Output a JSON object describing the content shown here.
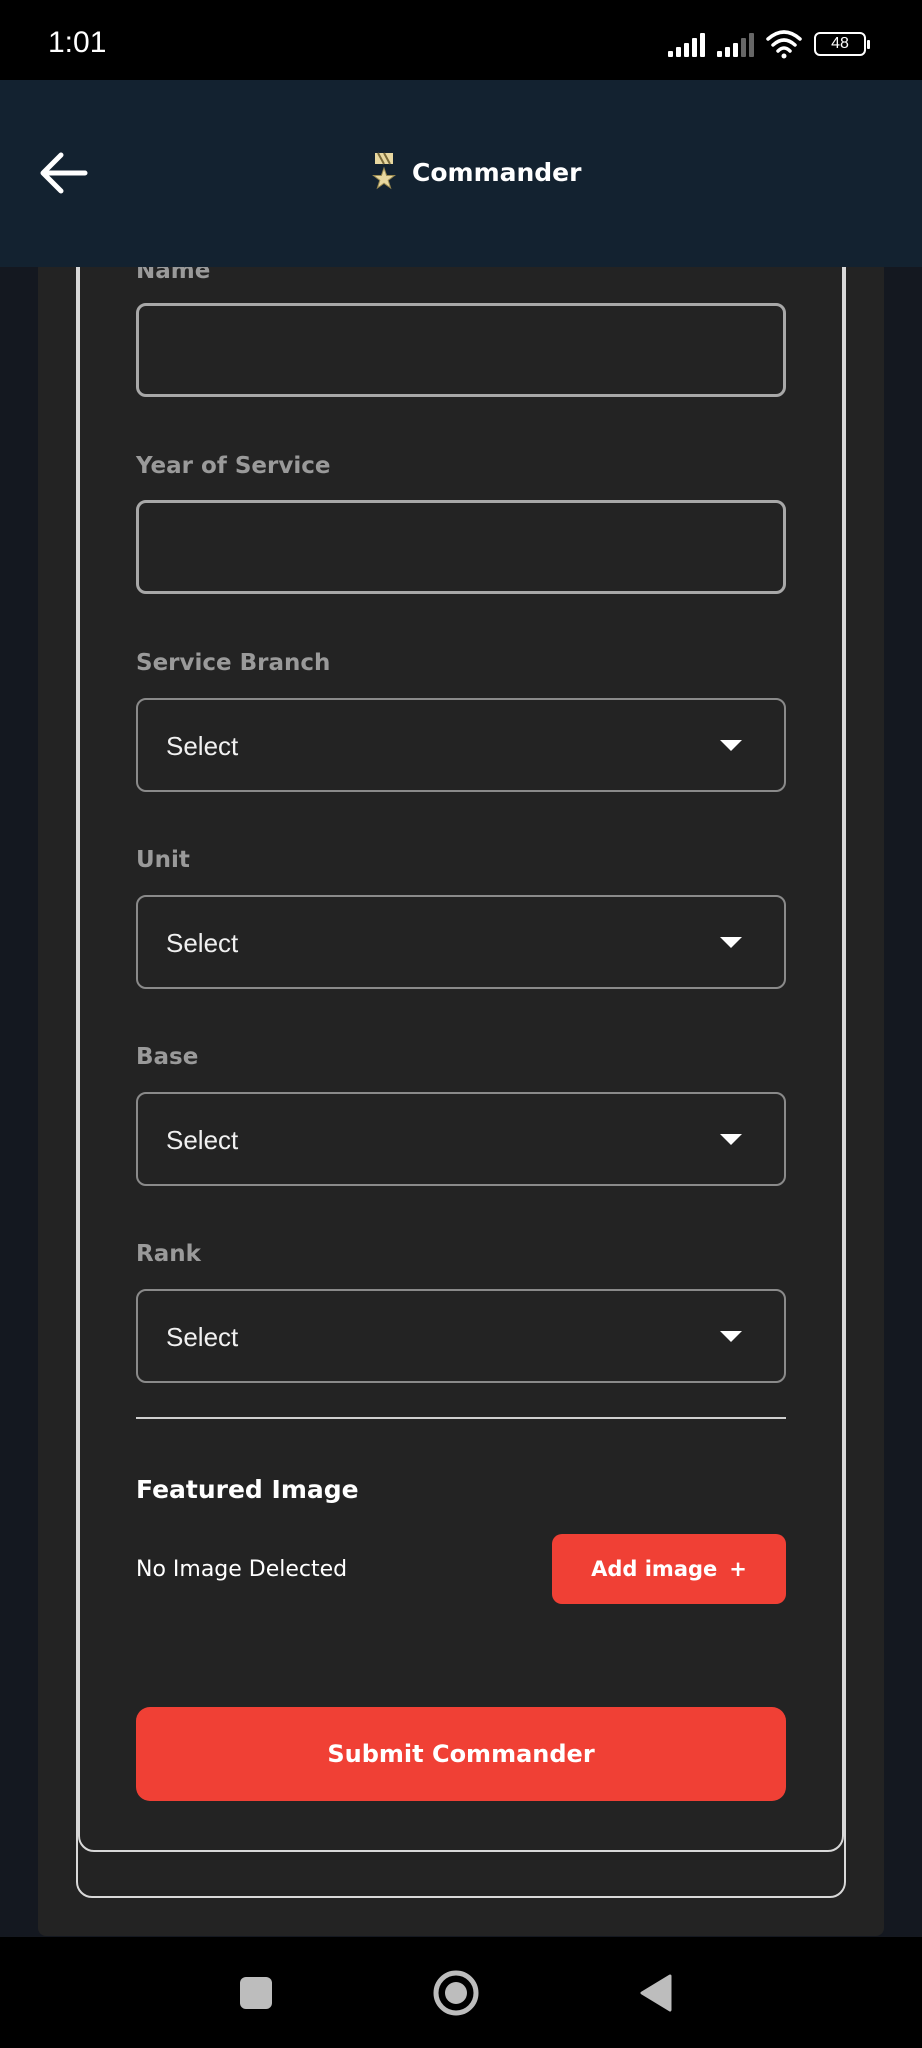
{
  "status_bar": {
    "time": "1:01",
    "battery": "48"
  },
  "app_bar": {
    "title": "Commander",
    "back_icon": "arrow-left-icon",
    "title_icon": "medal-icon"
  },
  "form": {
    "name": {
      "label": "Name",
      "value": ""
    },
    "year_of_service": {
      "label": "Year of Service",
      "value": ""
    },
    "service_branch": {
      "label": "Service Branch",
      "value": "Select"
    },
    "unit": {
      "label": "Unit",
      "value": "Select"
    },
    "base": {
      "label": "Base",
      "value": "Select"
    },
    "rank": {
      "label": "Rank",
      "value": "Select"
    }
  },
  "featured_image": {
    "title": "Featured Image",
    "status": "No Image Delected",
    "add_label": "Add image",
    "add_icon": "+"
  },
  "submit_label": "Submit Commander",
  "nav": {
    "recents_icon": "square-icon",
    "home_icon": "circle-icon",
    "back_icon": "triangle-back-icon"
  },
  "colors": {
    "accent": "#f04035",
    "app_bar": "#132230",
    "card": "#232323",
    "page_bg": "#141820"
  }
}
